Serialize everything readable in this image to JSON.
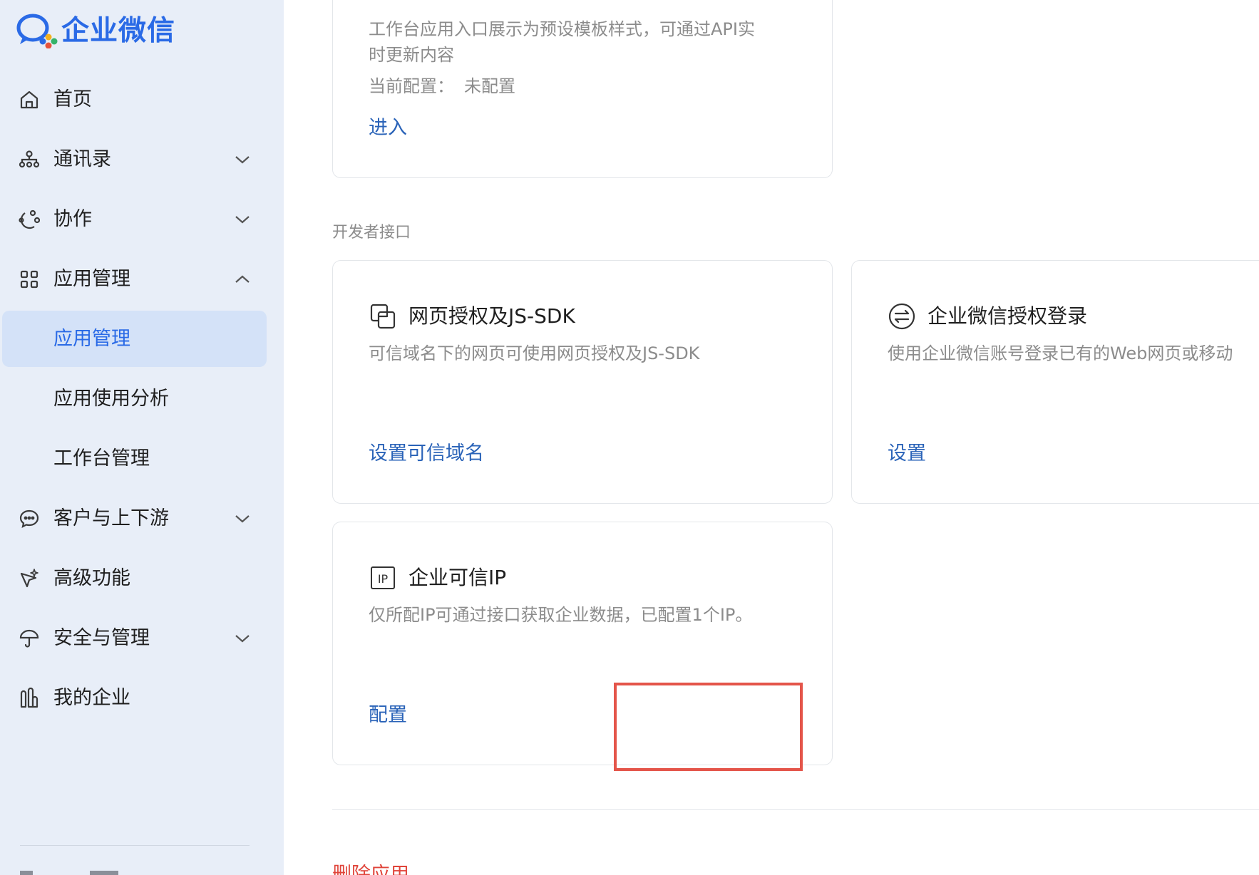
{
  "brand": {
    "name": "企业微信"
  },
  "sidebar": {
    "items": [
      {
        "label": "首页",
        "icon": "home-icon"
      },
      {
        "label": "通讯录",
        "icon": "org-chart-icon",
        "chevron": "down"
      },
      {
        "label": "协作",
        "icon": "collaboration-icon",
        "chevron": "down"
      },
      {
        "label": "应用管理",
        "icon": "apps-grid-icon",
        "chevron": "up"
      },
      {
        "label": "应用管理",
        "sub": true,
        "active": true
      },
      {
        "label": "应用使用分析",
        "sub": true
      },
      {
        "label": "工作台管理",
        "sub": true
      },
      {
        "label": "客户与上下游",
        "icon": "chat-bubble-icon",
        "chevron": "down"
      },
      {
        "label": "高级功能",
        "icon": "sparkle-pen-icon"
      },
      {
        "label": "安全与管理",
        "icon": "umbrella-icon",
        "chevron": "down"
      },
      {
        "label": "我的企业",
        "icon": "buildings-icon"
      }
    ]
  },
  "top_card": {
    "desc_line1": "工作台应用入口展示为预设模板样式，可通过API实",
    "desc_line2": "时更新内容",
    "config_label": "当前配置：",
    "config_value": "未配置",
    "link": "进入"
  },
  "developer_section": {
    "title": "开发者接口",
    "cards": [
      {
        "icon": "web-auth-icon",
        "title": "网页授权及JS-SDK",
        "desc": "可信域名下的网页可使用网页授权及JS-SDK",
        "link": "设置可信域名"
      },
      {
        "icon": "switch-arrows-icon",
        "title": "企业微信授权登录",
        "desc": "使用企业微信账号登录已有的Web网页或移动",
        "link": "设置"
      },
      {
        "icon": "ip-icon",
        "icon_text": "IP",
        "title": "企业可信IP",
        "desc": "仅所配IP可通过接口获取企业数据，已配置1个IP。",
        "link": "配置"
      }
    ]
  },
  "danger": {
    "label": "删除应用"
  },
  "colors": {
    "accent": "#2a6ae6",
    "link": "#2a63b8",
    "highlight": "#e4554a",
    "danger": "#e0443a"
  }
}
